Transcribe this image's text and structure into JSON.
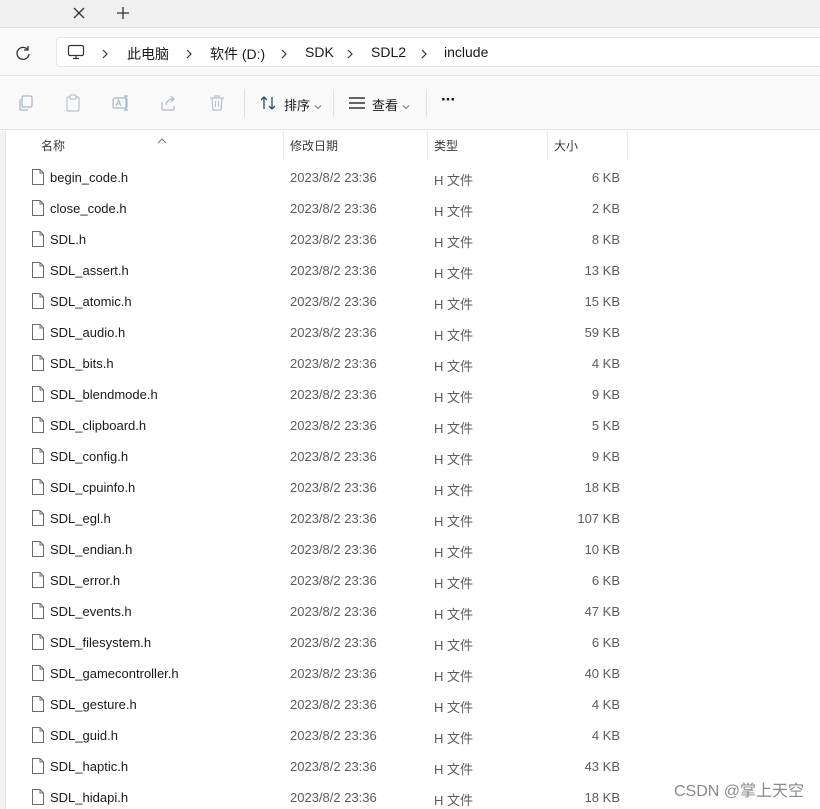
{
  "tabbar": {
    "close_icon": "close-icon",
    "new_tab_icon": "plus-icon"
  },
  "nav": {
    "refresh_icon": "refresh-icon"
  },
  "breadcrumb": {
    "device_icon": "monitor-icon",
    "items": [
      "此电脑",
      "软件 (D:)",
      "SDK",
      "SDL2",
      "include"
    ]
  },
  "toolbar": {
    "icons": [
      "copy-icon",
      "paste-icon",
      "rename-icon",
      "share-icon",
      "delete-icon"
    ],
    "sort_label": "排序",
    "view_label": "查看",
    "more_label": "···"
  },
  "columns": {
    "name": "名称",
    "date": "修改日期",
    "type": "类型",
    "size": "大小"
  },
  "files": [
    {
      "name": "begin_code.h",
      "date": "2023/8/2 23:36",
      "type": "H 文件",
      "size": "6 KB"
    },
    {
      "name": "close_code.h",
      "date": "2023/8/2 23:36",
      "type": "H 文件",
      "size": "2 KB"
    },
    {
      "name": "SDL.h",
      "date": "2023/8/2 23:36",
      "type": "H 文件",
      "size": "8 KB"
    },
    {
      "name": "SDL_assert.h",
      "date": "2023/8/2 23:36",
      "type": "H 文件",
      "size": "13 KB"
    },
    {
      "name": "SDL_atomic.h",
      "date": "2023/8/2 23:36",
      "type": "H 文件",
      "size": "15 KB"
    },
    {
      "name": "SDL_audio.h",
      "date": "2023/8/2 23:36",
      "type": "H 文件",
      "size": "59 KB"
    },
    {
      "name": "SDL_bits.h",
      "date": "2023/8/2 23:36",
      "type": "H 文件",
      "size": "4 KB"
    },
    {
      "name": "SDL_blendmode.h",
      "date": "2023/8/2 23:36",
      "type": "H 文件",
      "size": "9 KB"
    },
    {
      "name": "SDL_clipboard.h",
      "date": "2023/8/2 23:36",
      "type": "H 文件",
      "size": "5 KB"
    },
    {
      "name": "SDL_config.h",
      "date": "2023/8/2 23:36",
      "type": "H 文件",
      "size": "9 KB"
    },
    {
      "name": "SDL_cpuinfo.h",
      "date": "2023/8/2 23:36",
      "type": "H 文件",
      "size": "18 KB"
    },
    {
      "name": "SDL_egl.h",
      "date": "2023/8/2 23:36",
      "type": "H 文件",
      "size": "107 KB"
    },
    {
      "name": "SDL_endian.h",
      "date": "2023/8/2 23:36",
      "type": "H 文件",
      "size": "10 KB"
    },
    {
      "name": "SDL_error.h",
      "date": "2023/8/2 23:36",
      "type": "H 文件",
      "size": "6 KB"
    },
    {
      "name": "SDL_events.h",
      "date": "2023/8/2 23:36",
      "type": "H 文件",
      "size": "47 KB"
    },
    {
      "name": "SDL_filesystem.h",
      "date": "2023/8/2 23:36",
      "type": "H 文件",
      "size": "6 KB"
    },
    {
      "name": "SDL_gamecontroller.h",
      "date": "2023/8/2 23:36",
      "type": "H 文件",
      "size": "40 KB"
    },
    {
      "name": "SDL_gesture.h",
      "date": "2023/8/2 23:36",
      "type": "H 文件",
      "size": "4 KB"
    },
    {
      "name": "SDL_guid.h",
      "date": "2023/8/2 23:36",
      "type": "H 文件",
      "size": "4 KB"
    },
    {
      "name": "SDL_haptic.h",
      "date": "2023/8/2 23:36",
      "type": "H 文件",
      "size": "43 KB"
    },
    {
      "name": "SDL_hidapi.h",
      "date": "2023/8/2 23:36",
      "type": "H 文件",
      "size": "18 KB"
    }
  ],
  "watermark": "CSDN @掌上天空"
}
